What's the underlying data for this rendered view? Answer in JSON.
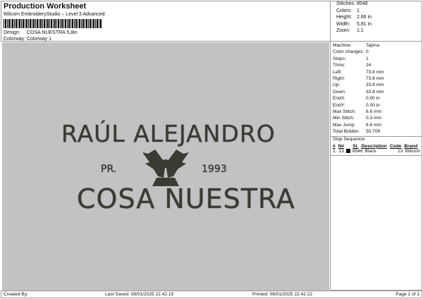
{
  "header": {
    "title": "Production Worksheet",
    "subtitle": "Wilcom EmbroideryStudio – Level 3 Advanced",
    "design_label": "Design:",
    "design": "COSA NUESTRA 5,8in",
    "colorway_label": "Colorway:",
    "colorway": "Colorway 1"
  },
  "stats": [
    {
      "k": "Stitches:",
      "v": "8548"
    },
    {
      "k": "Colors:",
      "v": "1"
    },
    {
      "k": "Height:",
      "v": "2.66 in"
    },
    {
      "k": "Width:",
      "v": "5.81 in"
    },
    {
      "k": "Zoom:",
      "v": "1:1"
    }
  ],
  "design": {
    "line1": "RAÚL ALEJANDRO",
    "pr": "PR.",
    "year": "1993",
    "line2": "COSA NUESTRA",
    "thread_color": "#3b3a33",
    "background": "#c2c2c2"
  },
  "machine": [
    {
      "k": "Machine:",
      "v": "Tajima"
    },
    {
      "k": "Color changes:",
      "v": "0"
    },
    {
      "k": "Stops:",
      "v": "1"
    },
    {
      "k": "Trims:",
      "v": "24"
    },
    {
      "k": "Left:",
      "v": "73.8 mm"
    },
    {
      "k": "Right:",
      "v": "73.8 mm"
    },
    {
      "k": "Up:",
      "v": "33.8 mm"
    },
    {
      "k": "Down:",
      "v": "33.8 mm"
    },
    {
      "k": "EndX:",
      "v": "0.00 in"
    },
    {
      "k": "EndY:",
      "v": "0.00 in"
    },
    {
      "k": "Max Stitch:",
      "v": "6.6 mm"
    },
    {
      "k": "Min Stitch:",
      "v": "0.3 mm"
    },
    {
      "k": "Max Jump:",
      "v": "6.6 mm"
    },
    {
      "k": "Total Bobbin:",
      "v": "50.70ft"
    }
  ],
  "stop_sequence": {
    "title": "Stop Sequence:",
    "headers": [
      "#",
      "N#",
      "St.",
      "Description",
      "Code",
      "Brand"
    ],
    "rows": [
      {
        "num": "1.",
        "n": "13",
        "st": "8546",
        "desc": "Black",
        "code": "13",
        "brand": "Wilcom"
      }
    ]
  },
  "footer": {
    "created": "Created By:",
    "saved": "Last Saved: 08/01/2025 22.42.19",
    "printed": "Printed: 08/01/2025 22.42.22",
    "page": "Page 1 of 1"
  }
}
